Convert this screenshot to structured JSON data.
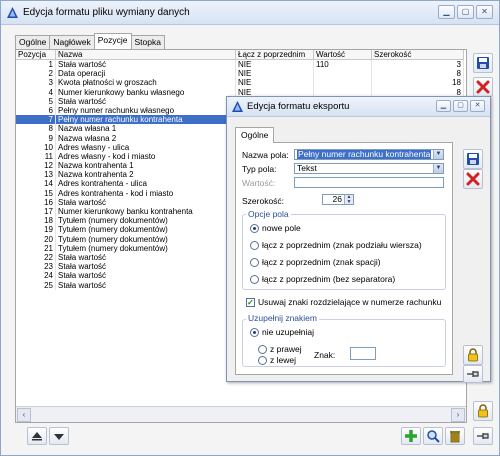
{
  "window": {
    "title": "Edycja formatu pliku wymiany danych"
  },
  "tabs": [
    "Ogólne",
    "Nagłówek",
    "Pozycje",
    "Stopka"
  ],
  "active_tab": "Pozycje",
  "grid": {
    "columns": [
      "Pozycja",
      "Nazwa",
      "Łącz z poprzednim",
      "Wartość",
      "Szerokość"
    ],
    "rows": [
      [
        "1",
        "Stała wartość",
        "NIE",
        "110",
        "3"
      ],
      [
        "2",
        "Data operacji",
        "NIE",
        "",
        "8"
      ],
      [
        "3",
        "Kwota płatności w groszach",
        "NIE",
        "",
        "18"
      ],
      [
        "4",
        "Numer kierunkowy banku własnego",
        "NIE",
        "",
        "8"
      ],
      [
        "5",
        "Stała wartość",
        "",
        "",
        ""
      ],
      [
        "6",
        "Pełny numer rachunku własnego",
        "",
        "",
        ""
      ],
      [
        "7",
        "Pełny numer rachunku kontrahenta",
        "",
        "",
        ""
      ],
      [
        "8",
        "Nazwa własna 1",
        "",
        "",
        ""
      ],
      [
        "9",
        "Nazwa własna 2",
        "",
        "",
        ""
      ],
      [
        "10",
        "Adres własny - ulica",
        "",
        "",
        ""
      ],
      [
        "11",
        "Adres własny - kod i miasto",
        "",
        "",
        ""
      ],
      [
        "12",
        "Nazwa kontrahenta 1",
        "",
        "",
        ""
      ],
      [
        "13",
        "Nazwa kontrahenta 2",
        "",
        "",
        ""
      ],
      [
        "14",
        "Adres kontrahenta - ulica",
        "",
        "",
        ""
      ],
      [
        "15",
        "Adres kontrahenta - kod i miasto",
        "",
        "",
        ""
      ],
      [
        "16",
        "Stała wartość",
        "",
        "",
        ""
      ],
      [
        "17",
        "Numer kierunkowy banku kontrahenta",
        "",
        "",
        ""
      ],
      [
        "18",
        "Tytułem (numery dokumentów)",
        "",
        "",
        ""
      ],
      [
        "19",
        "Tytułem (numery dokumentów)",
        "",
        "",
        ""
      ],
      [
        "20",
        "Tytułem (numery dokumentów)",
        "",
        "",
        ""
      ],
      [
        "21",
        "Tytułem (numery dokumentów)",
        "",
        "",
        ""
      ],
      [
        "22",
        "Stała wartość",
        "",
        "",
        ""
      ],
      [
        "23",
        "Stała wartość",
        "",
        "",
        ""
      ],
      [
        "24",
        "Stała wartość",
        "",
        "",
        ""
      ],
      [
        "25",
        "Stała wartość",
        "",
        "",
        ""
      ]
    ],
    "selected_row": 7
  },
  "dialog": {
    "title": "Edycja formatu eksportu",
    "tab": "Ogólne",
    "nazwa_pola_label": "Nazwa pola:",
    "nazwa_pola_value": "Pełny numer rachunku kontrahenta",
    "typ_pola_label": "Typ pola:",
    "typ_pola_value": "Tekst",
    "wartosc_label": "Wartość:",
    "szerokosc_label": "Szerokość:",
    "szerokosc_value": "26",
    "opcje_pola_title": "Opcje pola",
    "opcje": [
      "nowe pole",
      "łącz z poprzednim (znak podziału wiersza)",
      "łącz z poprzednim (znak spacji)",
      "łącz z poprzednim (bez separatora)"
    ],
    "opcje_selected": 0,
    "usuwaj_label": "Usuwaj znaki rozdzielające w numerze rachunku",
    "usuwaj_checked": true,
    "uzupelnij_title": "Uzupełnij znakiem",
    "nie_uzupelniaj": "nie uzupełniaj",
    "z_prawej": "z prawej",
    "z_lewej": "z lewej",
    "znak_label": "Znak:"
  },
  "icons": {
    "save": "save-disk-icon",
    "cancel": "cancel-x-icon",
    "lock": "lock-icon",
    "pin": "pin-icon",
    "add": "add-plus-icon",
    "find": "magnifier-icon",
    "delete": "trash-icon",
    "move_up": "move-up-icon",
    "move_down": "move-down-icon"
  },
  "colors": {
    "selection": "#3d6fc9",
    "add_green": "#2aa52a",
    "cancel_red": "#d42020",
    "save_blue": "#1f4fa8"
  }
}
